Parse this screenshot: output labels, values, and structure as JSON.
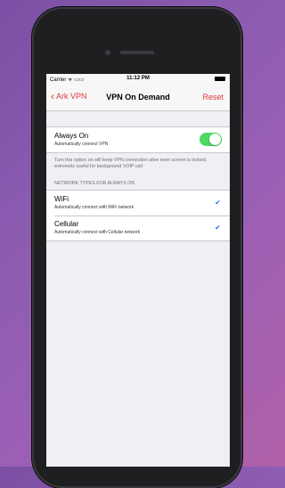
{
  "status": {
    "carrier": "Carrier ᯤ ▭▭",
    "time": "11:12 PM"
  },
  "nav": {
    "back_label": "Ark VPN",
    "title": "VPN On Demand",
    "right_label": "Reset"
  },
  "always_on": {
    "title": "Always On",
    "subtitle": "Automatically connect VPN",
    "enabled": true,
    "footer": "Turn this option on will keep VPN connection alive even screen is locked, extremely useful for background VOIP call"
  },
  "network_section": {
    "header": "NETWORK TYPES FOR ALWAYS ON",
    "items": [
      {
        "title": "WiFi",
        "subtitle": "Automatically connect with WiFi network",
        "checked": true
      },
      {
        "title": "Cellular",
        "subtitle": "Automatically connect with Cellular network",
        "checked": true
      }
    ]
  },
  "colors": {
    "accent": "#e0383e",
    "toggle_on": "#4cd964",
    "check": "#1e7ee8"
  }
}
